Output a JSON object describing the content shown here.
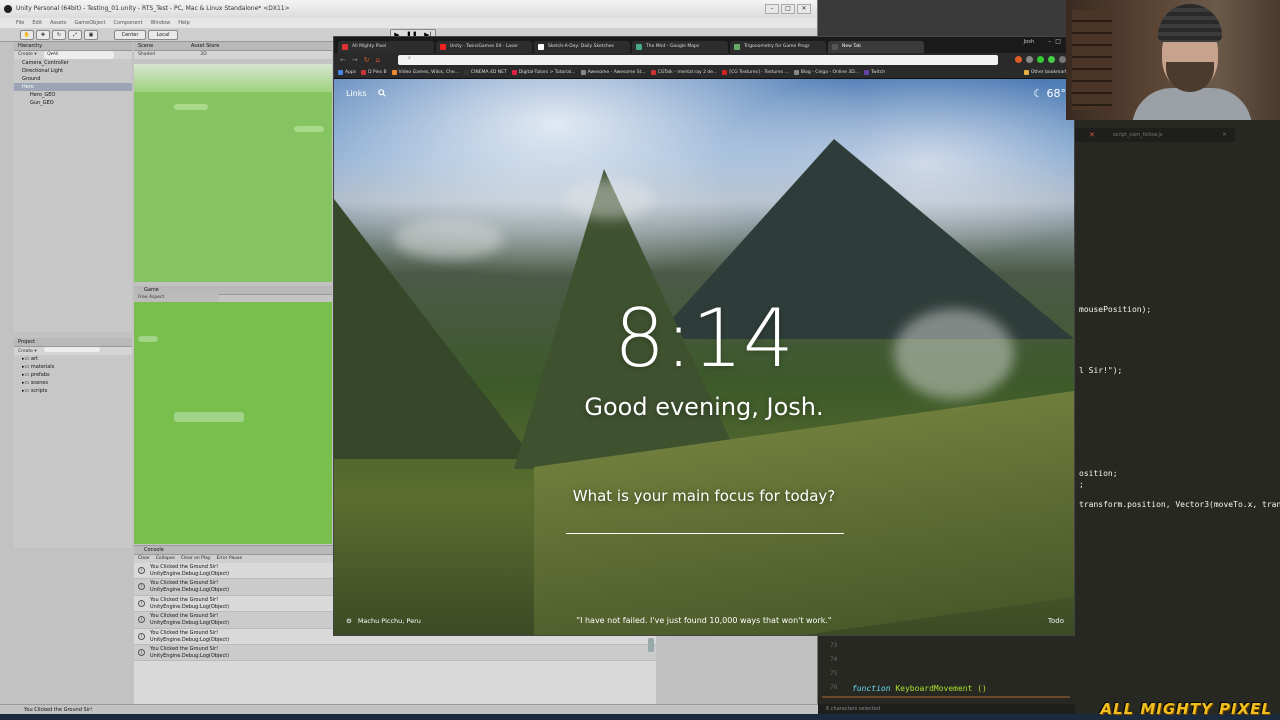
{
  "unity": {
    "title": "Unity Personal (64bit) - Testing_01.unity - RTS_Test - PC, Mac & Linux Standalone* <DX11>",
    "menu": [
      "File",
      "Edit",
      "Assets",
      "GameObject",
      "Component",
      "Window",
      "Help"
    ],
    "toolbar": {
      "center": "Center",
      "local": "Local"
    },
    "hierarchy": {
      "title": "Hierarchy",
      "create": "Create ▾",
      "search_placeholder": "Q▾All",
      "items": [
        "Camera_Controller",
        "Directional Light",
        "Ground",
        "Hero",
        "Hero_GEO",
        "Gun_GEO"
      ],
      "selected": "Hero"
    },
    "scene": {
      "tab": "Scene",
      "tab2": "Asset Store",
      "shading": "Shaded",
      "mode": "2D"
    },
    "game": {
      "tab": "Game",
      "aspect": "Free Aspect"
    },
    "project": {
      "title": "Project",
      "create": "Create ▾",
      "folders": [
        "art",
        "materials",
        "prefabs",
        "scenes",
        "scripts"
      ]
    },
    "console": {
      "tab": "Console",
      "buttons": [
        "Clear",
        "Collapse",
        "Clear on Play",
        "Error Pause"
      ],
      "logs": [
        {
          "msg": "You Clicked the Ground Sir!",
          "sub": "UnityEngine.Debug:Log(Object)"
        },
        {
          "msg": "You Clicked the Ground Sir!",
          "sub": "UnityEngine.Debug:Log(Object)"
        },
        {
          "msg": "You Clicked the Ground Sir!",
          "sub": "UnityEngine.Debug:Log(Object)"
        },
        {
          "msg": "You Clicked the Ground Sir!",
          "sub": "UnityEngine.Debug:Log(Object)"
        },
        {
          "msg": "You Clicked the Ground Sir!",
          "sub": "UnityEngine.Debug:Log(Object)"
        },
        {
          "msg": "You Clicked the Ground Sir!",
          "sub": "UnityEngine.Debug:Log(Object)"
        }
      ]
    },
    "status": "You Clicked the Ground Sir!"
  },
  "chrome": {
    "user": "Josh",
    "tabs": [
      {
        "label": "All Mighty Pixel",
        "color": "#d33"
      },
      {
        "label": "Unity - TwinsGames 04 - Laser",
        "color": "#e22"
      },
      {
        "label": "Sketch-A-Day: Daily Sketches",
        "color": "#fff"
      },
      {
        "label": "The Mint - Google Maps",
        "color": "#4a8"
      },
      {
        "label": "Trigonometry for Game Progr",
        "color": "#6a6"
      },
      {
        "label": "New Tab",
        "color": "#555"
      }
    ],
    "bookmarks": [
      {
        "label": "Apps",
        "color": "#4a86e8"
      },
      {
        "label": "D Pies B",
        "color": "#c33"
      },
      {
        "label": "Video Games, Wikis, Che...",
        "color": "#e83"
      },
      {
        "label": "CINEMA 4D NET",
        "color": "#333"
      },
      {
        "label": "Digital-Tutors > Tutorial...",
        "color": "#d24"
      },
      {
        "label": "Awesome - Awesome St...",
        "color": "#888"
      },
      {
        "label": "CGTalk - mental ray 2 de...",
        "color": "#c33"
      },
      {
        "label": "[CG Textures] - Textures ...",
        "color": "#c22"
      },
      {
        "label": "Blog - Ceiga - Online 3D...",
        "color": "#888"
      },
      {
        "label": "Twitch",
        "color": "#6441a4"
      },
      {
        "label": "Other bookmarks",
        "color": "#e0b040"
      }
    ],
    "newtab": {
      "links": "Links",
      "weather": "68°",
      "clock": "8:14",
      "greeting": "Good evening, Josh.",
      "focus": "What is your main focus for today?",
      "location": "Machu Picchu, Peru",
      "quote": "\"I have not failed. I've just found 10,000 ways that won't work.\"",
      "todo": "Todo"
    }
  },
  "editor": {
    "tab": "script_cam_follow.js",
    "lines": [
      "mousePosition);",
      "l Sir!\");",
      "osition;",
      ";",
      "transform.position, Vector3(moveTo.x, tran"
    ],
    "line_numbers": [
      "73",
      "74",
      "75",
      "76"
    ],
    "keyword": "function",
    "fn_name": "KeyboardMovement ()",
    "status": "6 characters selected"
  },
  "watermark": "ALL MIGHTY PIXEL"
}
